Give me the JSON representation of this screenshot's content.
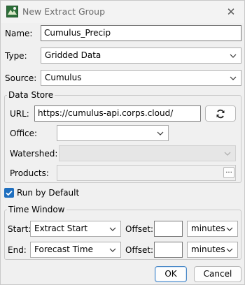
{
  "window": {
    "title": "New Extract Group",
    "close_glyph": "✕"
  },
  "form": {
    "name_label": "Name:",
    "name_value": "Cumulus_Precip",
    "type_label": "Type:",
    "type_value": "Gridded Data",
    "source_label": "Source:",
    "source_value": "Cumulus"
  },
  "data_store": {
    "title": "Data Store",
    "url_label": "URL:",
    "url_value": "https://cumulus-api.corps.cloud/",
    "refresh_icon": "refresh-icon",
    "office_label": "Office:",
    "office_value": "",
    "watershed_label": "Watershed:",
    "watershed_value": "",
    "products_label": "Products:",
    "products_value": "",
    "products_browse": "..."
  },
  "run_by_default": {
    "label": "Run by Default",
    "checked": true
  },
  "time_window": {
    "title": "Time Window",
    "start_label": "Start:",
    "start_value": "Extract Start",
    "start_offset_label": "Offset:",
    "start_offset_value": "",
    "start_unit": "minutes",
    "end_label": "End:",
    "end_value": "Forecast Time",
    "end_offset_label": "Offset:",
    "end_offset_value": "",
    "end_unit": "minutes"
  },
  "buttons": {
    "ok": "OK",
    "cancel": "Cancel"
  },
  "colors": {
    "accent": "#1f6fbf",
    "background": "#f0f0f0"
  }
}
